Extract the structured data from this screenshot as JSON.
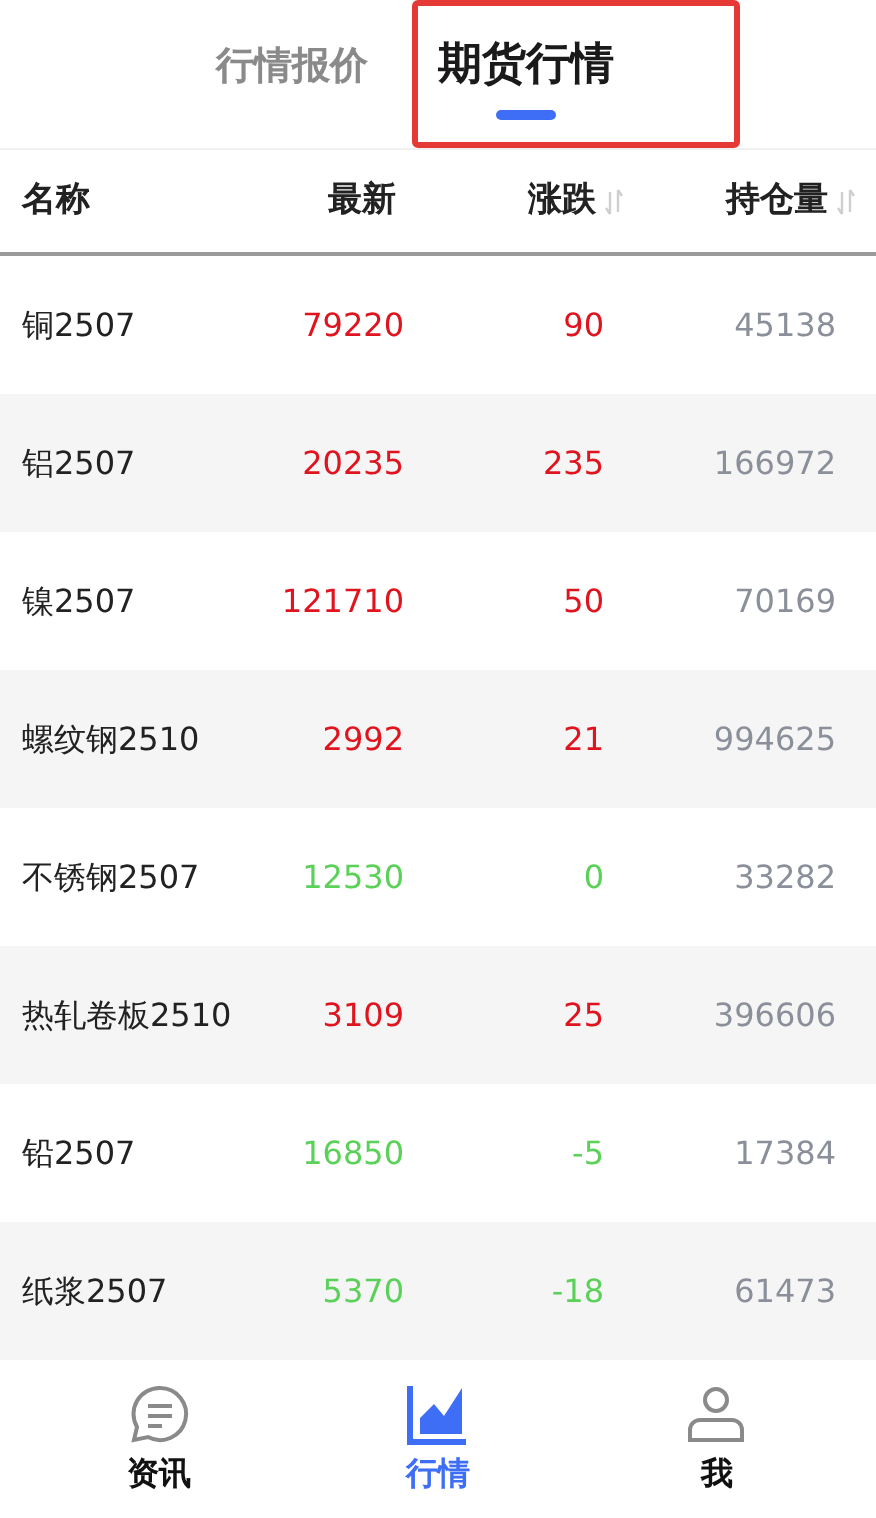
{
  "tabs": [
    {
      "label": "行情报价",
      "selected": false,
      "annotated": false
    },
    {
      "label": "期货行情",
      "selected": true,
      "annotated": true
    }
  ],
  "table": {
    "columns": [
      {
        "label": "名称",
        "sortable": false
      },
      {
        "label": "最新",
        "sortable": false
      },
      {
        "label": "涨跌",
        "sortable": true
      },
      {
        "label": "持仓量",
        "sortable": true
      }
    ],
    "rows": [
      {
        "name": "铜2507",
        "latest": "79220",
        "change": "90",
        "open_interest": "45138",
        "color": "#e0141e"
      },
      {
        "name": "铝2507",
        "latest": "20235",
        "change": "235",
        "open_interest": "166972",
        "color": "#e0141e"
      },
      {
        "name": "镍2507",
        "latest": "121710",
        "change": "50",
        "open_interest": "70169",
        "color": "#e0141e"
      },
      {
        "name": "螺纹钢2510",
        "latest": "2992",
        "change": "21",
        "open_interest": "994625",
        "color": "#e0141e"
      },
      {
        "name": "不锈钢2507",
        "latest": "12530",
        "change": "0",
        "open_interest": "33282",
        "color": "#5bd15a"
      },
      {
        "name": "热轧卷板2510",
        "latest": "3109",
        "change": "25",
        "open_interest": "396606",
        "color": "#e0141e"
      },
      {
        "name": "铅2507",
        "latest": "16850",
        "change": "-5",
        "open_interest": "17384",
        "color": "#5bd15a"
      },
      {
        "name": "纸浆2507",
        "latest": "5370",
        "change": "-18",
        "open_interest": "61473",
        "color": "#5bd15a"
      }
    ]
  },
  "bottom_nav": [
    {
      "label": "资讯",
      "kind": "chat",
      "selected": false
    },
    {
      "label": "行情",
      "kind": "chart",
      "selected": true
    },
    {
      "label": "我",
      "kind": "person",
      "selected": false
    }
  ]
}
